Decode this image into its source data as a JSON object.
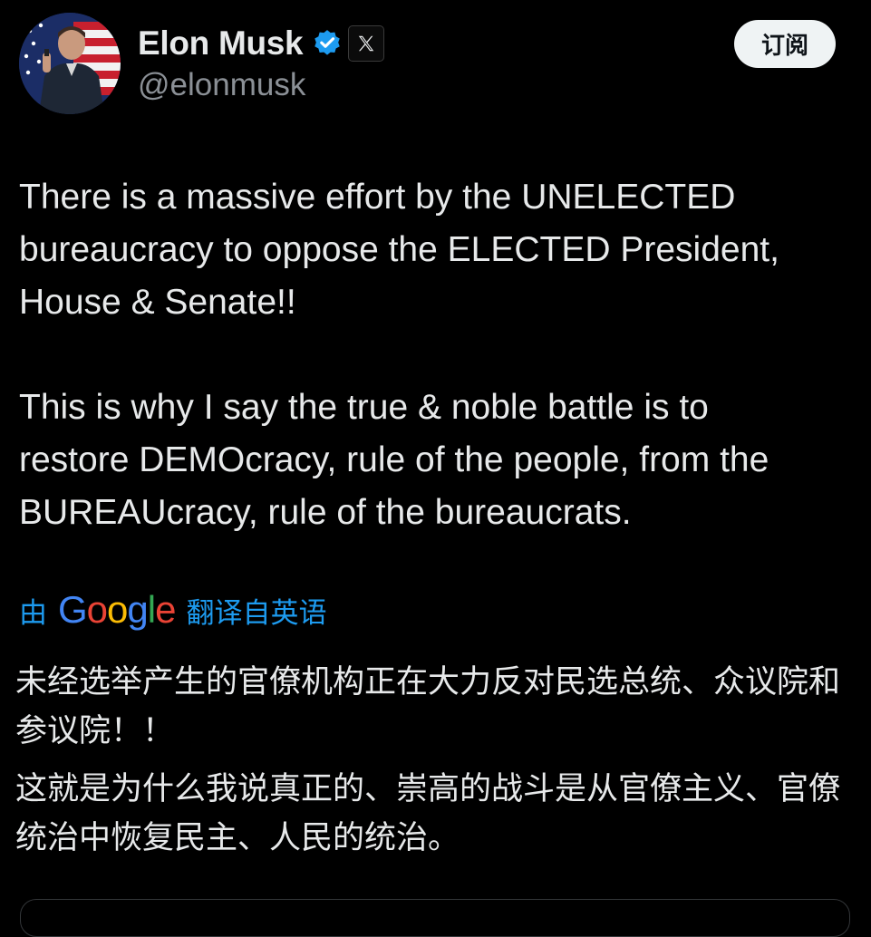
{
  "author": {
    "display_name": "Elon Musk",
    "handle": "@elonmusk"
  },
  "icons": {
    "avatar": "profile-photo-american-flag",
    "verified": "verified-badge-icon",
    "affiliate": "x-logo-icon"
  },
  "colors": {
    "background": "#000000",
    "text": "#e7e9ea",
    "muted": "#8b9096",
    "link": "#1d9bf0",
    "verified": "#1d9bf0"
  },
  "actions": {
    "subscribe_label": "订阅"
  },
  "tweet": {
    "paragraph_1": "There is a massive effort by the UNELECTED\nbureaucracy to oppose the ELECTED President,\nHouse & Senate!!",
    "paragraph_2": "This is why I say the true & noble battle is to\nrestore DEMOcracy, rule of the people, from the\nBUREAUcracy, rule of the bureaucrats."
  },
  "translation": {
    "prefix": "由",
    "provider": "Google",
    "suffix": "翻译自英语",
    "paragraph_1": "未经选举产生的官僚机构正在大力反对民选总统、众议院和参议院！！",
    "paragraph_2": "这就是为什么我说真正的、崇高的战斗是从官僚主义、官僚统治中恢复民主、人民的统治。"
  }
}
